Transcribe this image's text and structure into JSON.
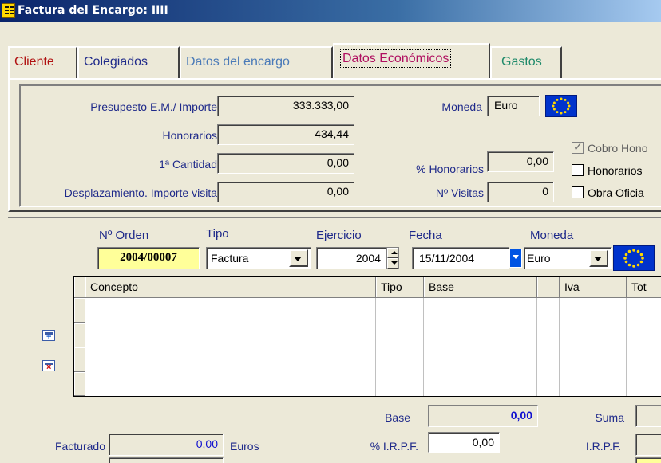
{
  "window": {
    "title": "Factura del Encargo: IIII"
  },
  "tabs": [
    {
      "label": "Cliente",
      "color": "#b01010"
    },
    {
      "label": "Colegiados",
      "color": "#1f2a8a"
    },
    {
      "label": "Datos del encargo",
      "color": "#4a7ab8"
    },
    {
      "label": "Datos Económicos",
      "color": "#b01060",
      "active": true
    },
    {
      "label": "Gastos",
      "color": "#1f8a6a"
    }
  ],
  "economicos": {
    "presupuesto_label": "Presupesto E.M./ Importe",
    "presupuesto_value": "333.333,00",
    "honorarios_label": "Honorarios",
    "honorarios_value": "434,44",
    "cantidad_label": "1ª Cantidad",
    "cantidad_value": "0,00",
    "desplazamiento_label": "Desplazamiento. Importe visita",
    "desplazamiento_value": "0,00",
    "moneda_label": "Moneda",
    "moneda_value": "Euro",
    "pct_honorarios_label": "% Honorarios",
    "pct_honorarios_value": "0,00",
    "visitas_label": "Nº Visitas",
    "visitas_value": "0",
    "checkboxes": [
      {
        "label": "Cobro Hono",
        "checked": true
      },
      {
        "label": "Honorarios",
        "checked": false
      },
      {
        "label": "Obra Oficia",
        "checked": false
      }
    ]
  },
  "invoice": {
    "orden_label": "Nº Orden",
    "orden_value": "2004/00007",
    "tipo_label": "Tipo",
    "tipo_value": "Factura",
    "ejercicio_label": "Ejercicio",
    "ejercicio_value": "2004",
    "fecha_label": "Fecha",
    "fecha_value": "15/11/2004",
    "moneda_label": "Moneda",
    "moneda_value": "Euro"
  },
  "grid": {
    "columns": [
      "Concepto",
      "Tipo",
      "Base",
      "",
      "Iva",
      "Tot"
    ]
  },
  "totals": {
    "base_label": "Base",
    "base_value": "0,00",
    "suma_label": "Suma",
    "facturado_label": "Facturado",
    "facturado_value": "0,00",
    "euros_label": "Euros",
    "irpf_pct_label": "% I.R.P.F.",
    "irpf_pct_value": "0,00",
    "irpf_label": "I.R.P.F."
  },
  "icons": [
    "app-icon",
    "eu-flag-icon",
    "add-row-icon",
    "delete-row-icon"
  ],
  "colors": {
    "label_blue": "#1f2a8a",
    "highlight_yellow": "#ffff99",
    "eu_blue": "#0033cc"
  }
}
